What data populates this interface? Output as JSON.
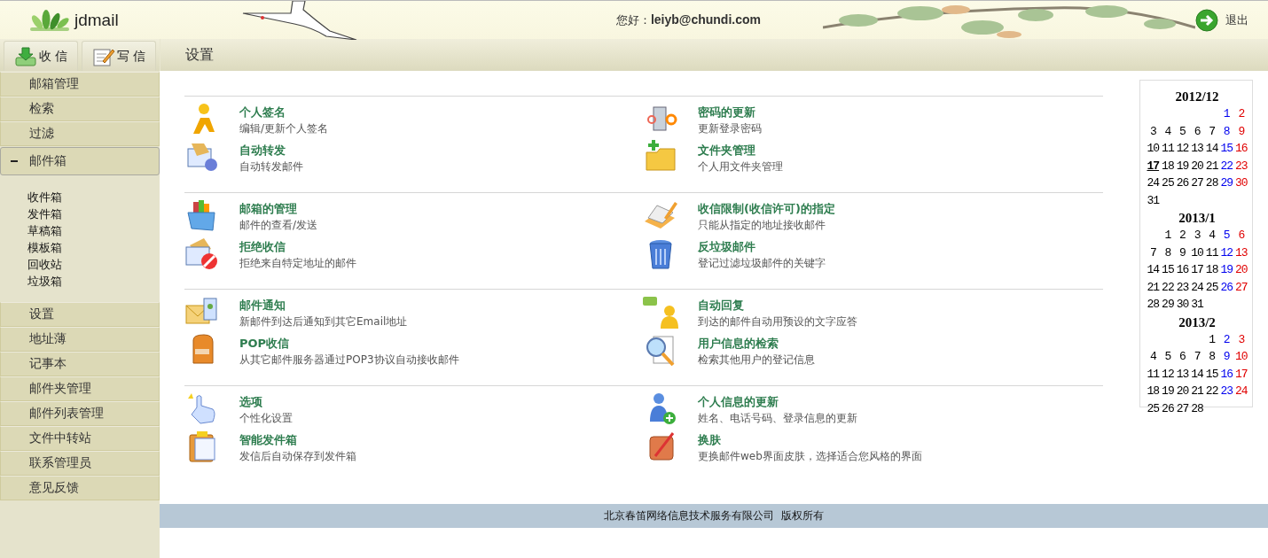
{
  "header": {
    "logo": "jdmail",
    "greeting": "您好：**leiyb@chundi.com**",
    "logout": "退出"
  },
  "toolbar": {
    "buttons": [
      {
        "label": "收 信",
        "kind": "receive"
      },
      {
        "label": "写 信",
        "kind": "compose"
      }
    ],
    "title": "设置"
  },
  "sidebar": {
    "items": [
      {
        "label": "邮箱管理",
        "kind": "item"
      },
      {
        "label": "检索",
        "kind": "item"
      },
      {
        "label": "过滤",
        "kind": "item"
      },
      {
        "label": "邮件箱",
        "kind": "group",
        "expanded": true,
        "children": [
          {
            "label": "收件箱"
          },
          {
            "label": "发件箱"
          },
          {
            "label": "草稿箱"
          },
          {
            "label": "模板箱"
          },
          {
            "label": "回收站"
          },
          {
            "label": "垃圾箱"
          }
        ]
      },
      {
        "label": "设置",
        "kind": "item"
      },
      {
        "label": "地址薄",
        "kind": "item"
      },
      {
        "label": "记事本",
        "kind": "item"
      },
      {
        "label": "邮件夹管理",
        "kind": "item"
      },
      {
        "label": "邮件列表管理",
        "kind": "item"
      },
      {
        "label": "文件中转站",
        "kind": "item"
      },
      {
        "label": "联系管理员",
        "kind": "item"
      },
      {
        "label": "意见反馈",
        "kind": "item"
      }
    ]
  },
  "sections": [
    {
      "items": [
        {
          "title": "个人签名",
          "desc": "编辑/更新个人签名"
        },
        {
          "title": "密码的更新",
          "desc": "更新登录密码"
        },
        {
          "title": "自动转发",
          "desc": "自动转发邮件"
        },
        {
          "title": "文件夹管理",
          "desc": "个人用文件夹管理"
        }
      ]
    },
    {
      "items": [
        {
          "title": "邮箱的管理",
          "desc": "邮件的查看/发送"
        },
        {
          "title": "收信限制(收信许可)的指定",
          "desc": "只能从指定的地址接收邮件"
        },
        {
          "title": "拒绝收信",
          "desc": "拒绝来自特定地址的邮件"
        },
        {
          "title": "反垃圾邮件",
          "desc": "登记过滤垃圾邮件的关键字"
        }
      ]
    },
    {
      "items": [
        {
          "title": "邮件通知",
          "desc": "新邮件到达后通知到其它Email地址"
        },
        {
          "title": "自动回复",
          "desc": "到达的邮件自动用预设的文字应答"
        },
        {
          "title": "POP收信",
          "desc": "从其它邮件服务器通过POP3协议自动接收邮件"
        },
        {
          "title": "用户信息的检索",
          "desc": "检索其他用户的登记信息"
        }
      ]
    },
    {
      "items": [
        {
          "title": "选项",
          "desc": "个性化设置"
        },
        {
          "title": "个人信息的更新",
          "desc": "姓名、电话号码、登录信息的更新"
        },
        {
          "title": "智能发件箱",
          "desc": "发信后自动保存到发件箱"
        },
        {
          "title": "换肤",
          "desc": "更换邮件web界面皮肤，选择适合您风格的界面"
        }
      ]
    }
  ],
  "calendar": [
    {
      "title": "2012/12",
      "weeks": [
        {
          "days": [
            {
              "d": "1",
              "today": false
            },
            {
              "d": "2",
              "today": false
            }
          ]
        },
        {
          "days": [
            {
              "d": "3",
              "today": false
            },
            {
              "d": "4",
              "today": false
            },
            {
              "d": "5",
              "today": false
            },
            {
              "d": "6",
              "today": false
            },
            {
              "d": "7",
              "today": false
            },
            {
              "d": "8",
              "today": false
            },
            {
              "d": "9",
              "today": false
            }
          ]
        },
        {
          "days": [
            {
              "d": "10",
              "today": false
            },
            {
              "d": "11",
              "today": false
            },
            {
              "d": "12",
              "today": false
            },
            {
              "d": "13",
              "today": false
            },
            {
              "d": "14",
              "today": false
            },
            {
              "d": "15",
              "today": false
            },
            {
              "d": "16",
              "today": false
            }
          ]
        },
        {
          "days": [
            {
              "d": "17",
              "today": true
            },
            {
              "d": "18",
              "today": false
            },
            {
              "d": "19",
              "today": false
            },
            {
              "d": "20",
              "today": false
            },
            {
              "d": "21",
              "today": false
            },
            {
              "d": "22",
              "today": false
            },
            {
              "d": "23",
              "today": false
            }
          ]
        },
        {
          "days": [
            {
              "d": "24",
              "today": false
            },
            {
              "d": "25",
              "today": false
            },
            {
              "d": "26",
              "today": false
            },
            {
              "d": "27",
              "today": false
            },
            {
              "d": "28",
              "today": false
            },
            {
              "d": "29",
              "today": false
            },
            {
              "d": "30",
              "today": false
            }
          ]
        },
        {
          "days": [
            {
              "d": "31",
              "today": false
            }
          ]
        }
      ]
    },
    {
      "title": "2013/1",
      "weeks": [
        {
          "days": [
            {
              "d": "1",
              "today": false
            },
            {
              "d": "2",
              "today": false
            },
            {
              "d": "3",
              "today": false
            },
            {
              "d": "4",
              "today": false
            },
            {
              "d": "5",
              "today": false
            },
            {
              "d": "6",
              "today": false
            }
          ]
        },
        {
          "days": [
            {
              "d": "7",
              "today": false
            },
            {
              "d": "8",
              "today": false
            },
            {
              "d": "9",
              "today": false
            },
            {
              "d": "10",
              "today": false
            },
            {
              "d": "11",
              "today": false
            },
            {
              "d": "12",
              "today": false
            },
            {
              "d": "13",
              "today": false
            }
          ]
        },
        {
          "days": [
            {
              "d": "14",
              "today": false
            },
            {
              "d": "15",
              "today": false
            },
            {
              "d": "16",
              "today": false
            },
            {
              "d": "17",
              "today": false
            },
            {
              "d": "18",
              "today": false
            },
            {
              "d": "19",
              "today": false
            },
            {
              "d": "20",
              "today": false
            }
          ]
        },
        {
          "days": [
            {
              "d": "21",
              "today": false
            },
            {
              "d": "22",
              "today": false
            },
            {
              "d": "23",
              "today": false
            },
            {
              "d": "24",
              "today": false
            },
            {
              "d": "25",
              "today": false
            },
            {
              "d": "26",
              "today": false
            },
            {
              "d": "27",
              "today": false
            }
          ]
        },
        {
          "days": [
            {
              "d": "28",
              "today": false
            },
            {
              "d": "29",
              "today": false
            },
            {
              "d": "30",
              "today": false
            },
            {
              "d": "31",
              "today": false
            }
          ]
        }
      ]
    },
    {
      "title": "2013/2",
      "weeks": [
        {
          "days": [
            {
              "d": "1",
              "today": false
            },
            {
              "d": "2",
              "today": false
            },
            {
              "d": "3",
              "today": false
            }
          ]
        },
        {
          "days": [
            {
              "d": "4",
              "today": false
            },
            {
              "d": "5",
              "today": false
            },
            {
              "d": "6",
              "today": false
            },
            {
              "d": "7",
              "today": false
            },
            {
              "d": "8",
              "today": false
            },
            {
              "d": "9",
              "today": false
            },
            {
              "d": "10",
              "today": false
            }
          ]
        },
        {
          "days": [
            {
              "d": "11",
              "today": false
            },
            {
              "d": "12",
              "today": false
            },
            {
              "d": "13",
              "today": false
            },
            {
              "d": "14",
              "today": false
            },
            {
              "d": "15",
              "today": false
            },
            {
              "d": "16",
              "today": false
            },
            {
              "d": "17",
              "today": false
            }
          ]
        },
        {
          "days": [
            {
              "d": "18",
              "today": false
            },
            {
              "d": "19",
              "today": false
            },
            {
              "d": "20",
              "today": false
            },
            {
              "d": "21",
              "today": false
            },
            {
              "d": "22",
              "today": false
            },
            {
              "d": "23",
              "today": false
            },
            {
              "d": "24",
              "today": false
            }
          ]
        },
        {
          "days": [
            {
              "d": "25",
              "today": false
            },
            {
              "d": "26",
              "today": false
            },
            {
              "d": "27",
              "today": false
            },
            {
              "d": "28",
              "today": false
            }
          ]
        }
      ]
    }
  ],
  "footer": "北京春笛网络信息技术服务有限公司  版权所有"
}
